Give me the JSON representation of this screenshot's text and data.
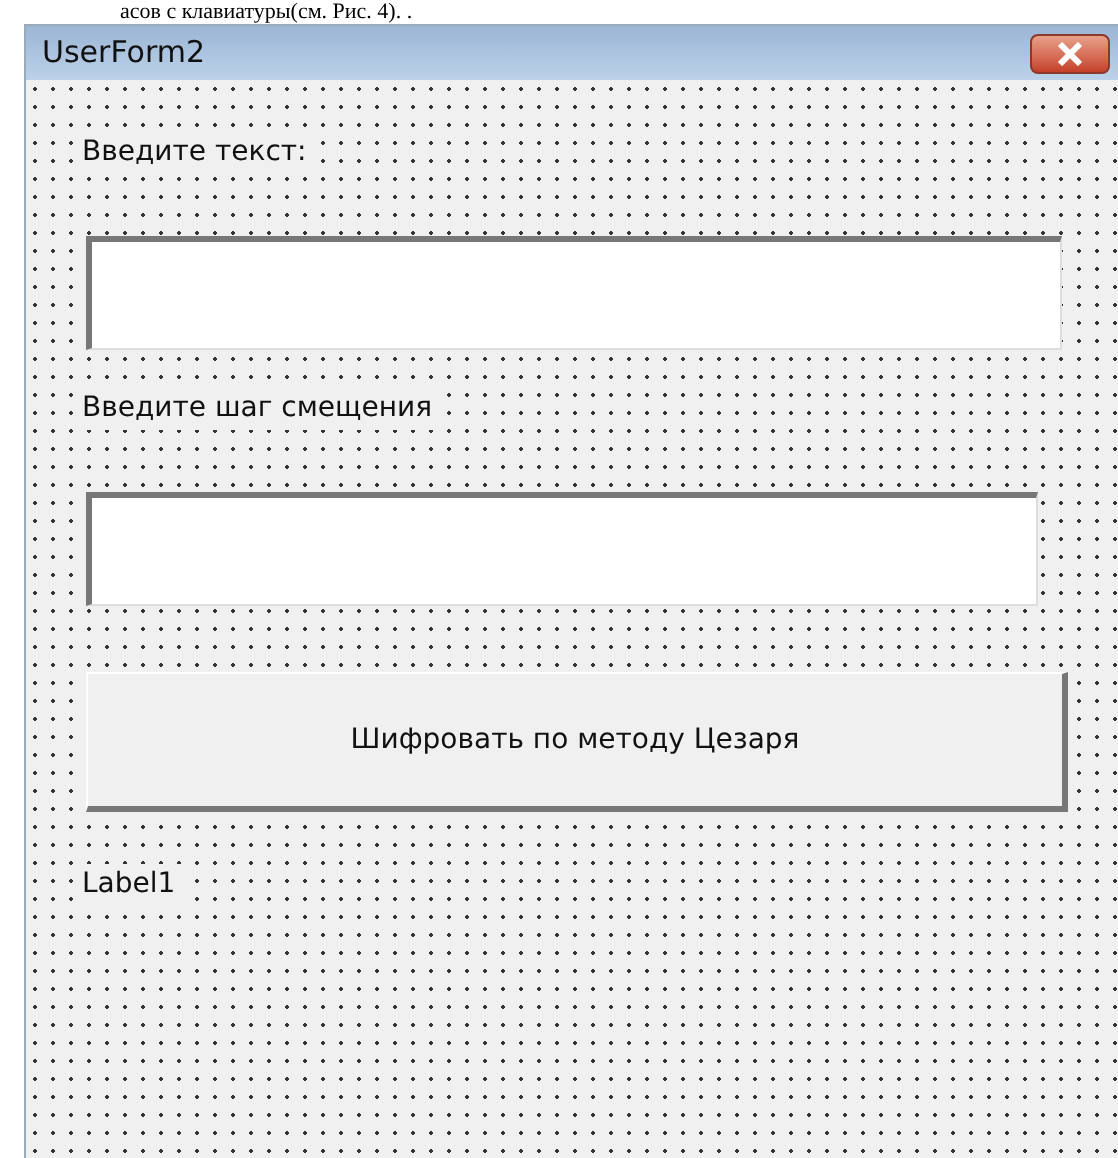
{
  "document_text": "асов с клавиатуры(см. Рис. 4). .",
  "window": {
    "title": "UserForm2"
  },
  "controls": [
    {
      "kind": "label",
      "text": "Введите текст:"
    },
    {
      "kind": "textbox",
      "wide": true
    },
    {
      "kind": "label",
      "text": "Введите шаг смещения"
    },
    {
      "kind": "textbox",
      "wide": false
    },
    {
      "kind": "button",
      "text": "Шифровать по методу Цезаря"
    },
    {
      "kind": "label",
      "text": "Label1"
    }
  ]
}
